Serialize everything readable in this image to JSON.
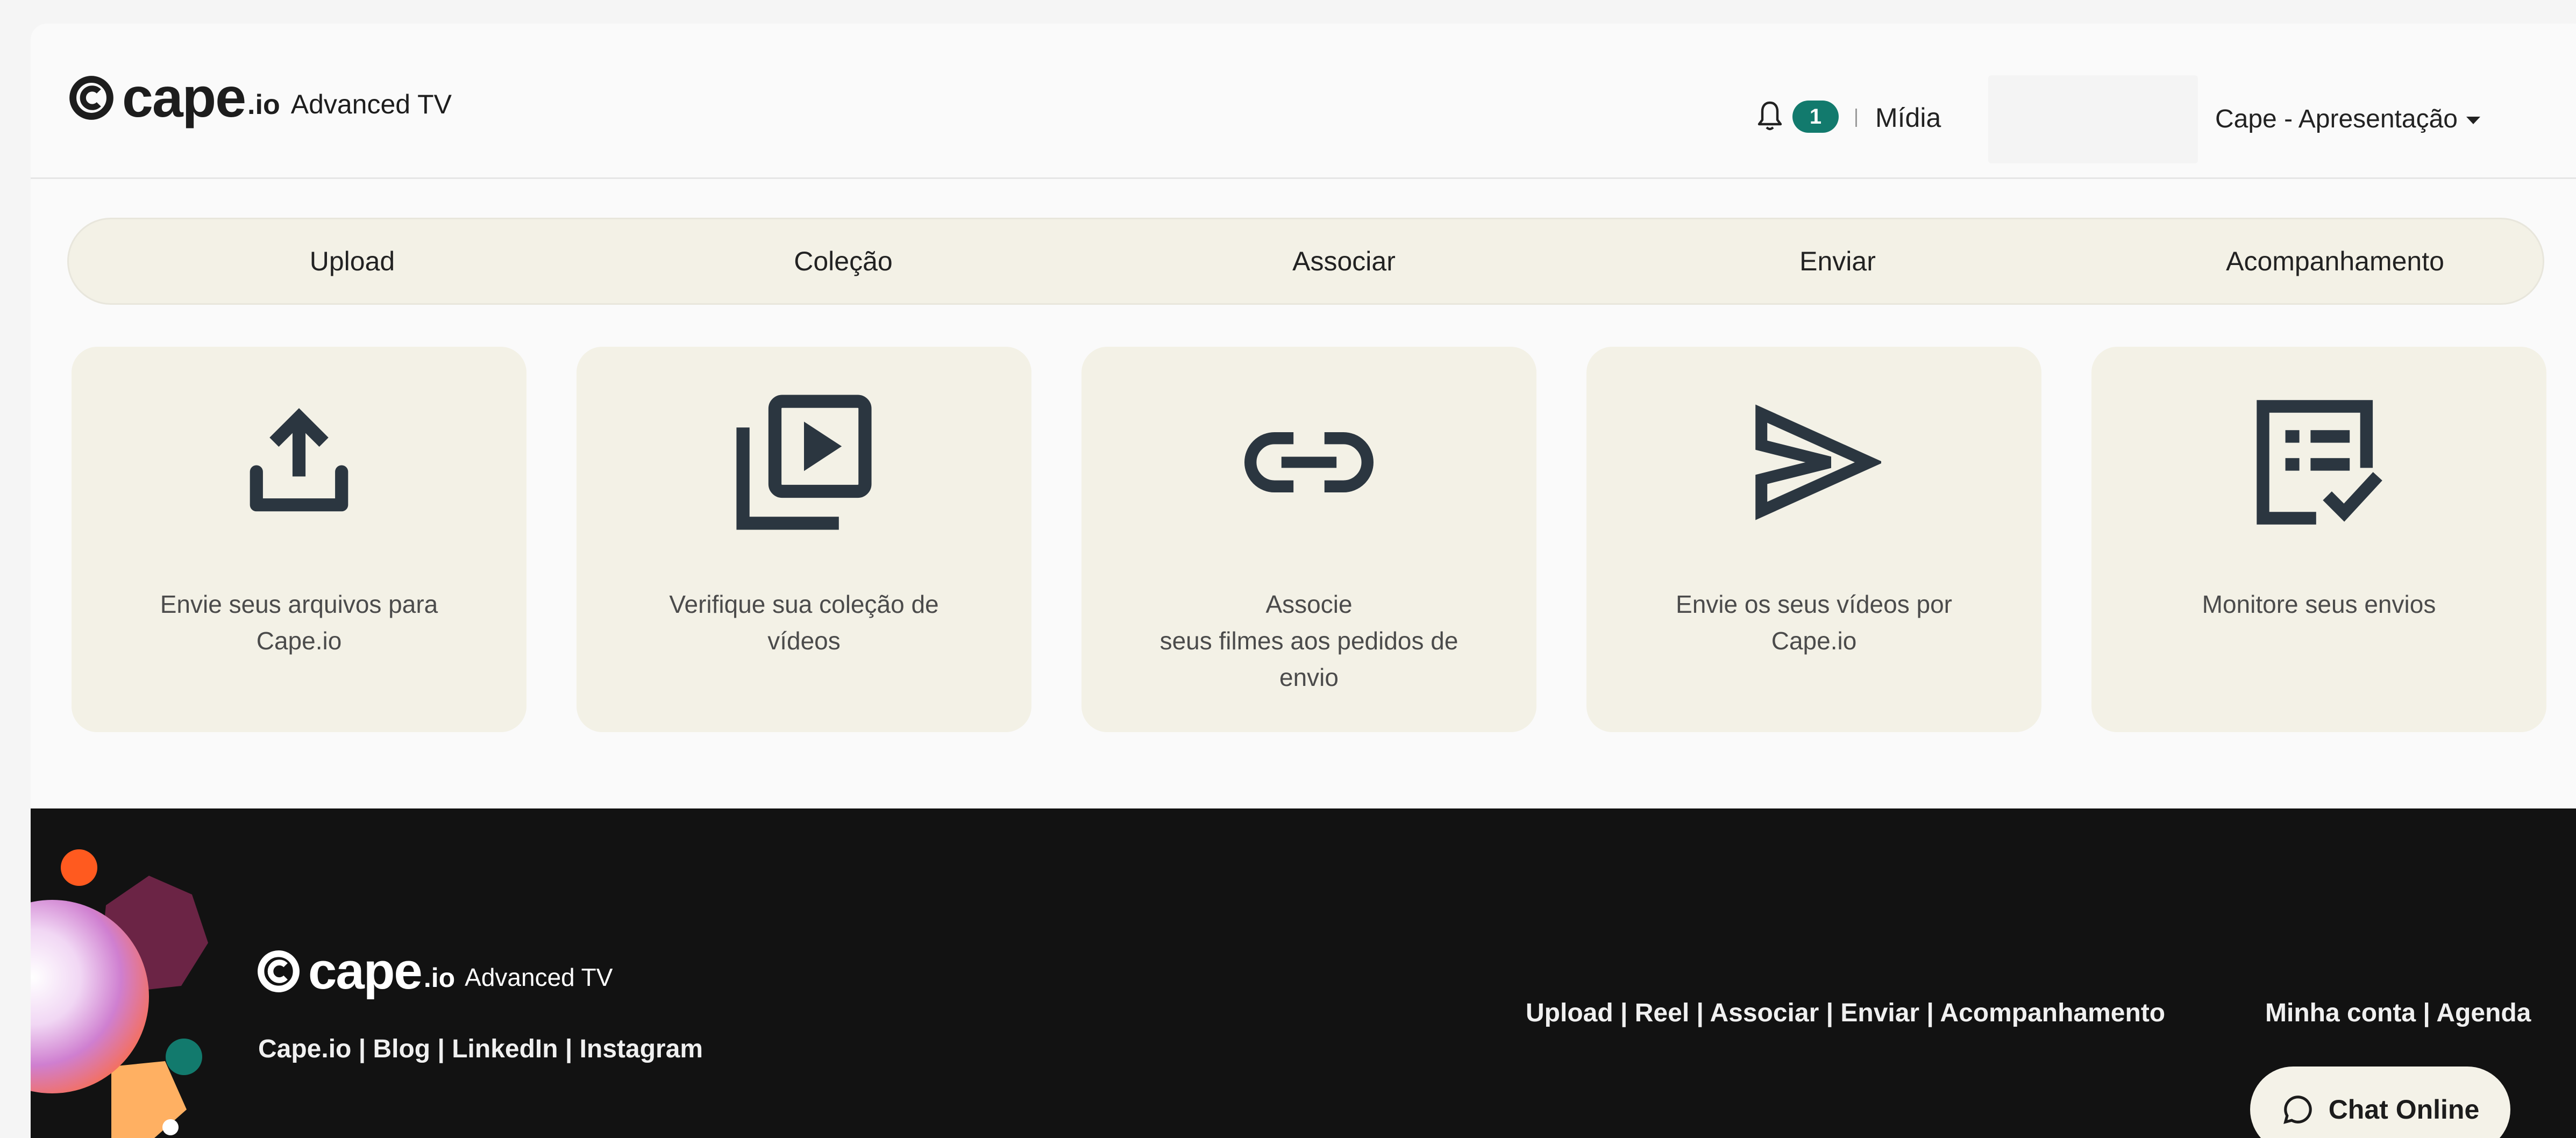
{
  "header": {
    "brand_word": "cape",
    "brand_io": ".io",
    "brand_product": "Advanced TV",
    "notification_count": "1",
    "section_link": "Mídia",
    "account_menu": "Cape - Apresentação"
  },
  "tabs": [
    "Upload",
    "Coleção",
    "Associar",
    "Enviar",
    "Acompanhamento"
  ],
  "cards": [
    {
      "icon": "upload-icon",
      "text": "Envie seus arquivos para\nCape.io"
    },
    {
      "icon": "video-library-icon",
      "text": "Verifique sua coleção de\nvídeos"
    },
    {
      "icon": "link-icon",
      "text": "Associe\nseus filmes aos pedidos de\nenvio"
    },
    {
      "icon": "send-icon",
      "text": "Envie os seus vídeos por\nCape.io"
    },
    {
      "icon": "checklist-icon",
      "text": "Monitore seus envios"
    }
  ],
  "footer": {
    "brand_word": "cape",
    "brand_io": ".io",
    "brand_product": "Advanced TV",
    "links_social": "Cape.io | Blog | LinkedIn | Instagram",
    "links_nav": "Upload | Reel | Associar | Enviar | Acompanhamento",
    "links_account": "Minha conta | Agenda",
    "chat_label": "Chat Online"
  },
  "colors": {
    "accent": "#127a6d",
    "card_bg": "#f3f1e6",
    "icon": "#2b3640",
    "footer_bg": "#121212"
  }
}
